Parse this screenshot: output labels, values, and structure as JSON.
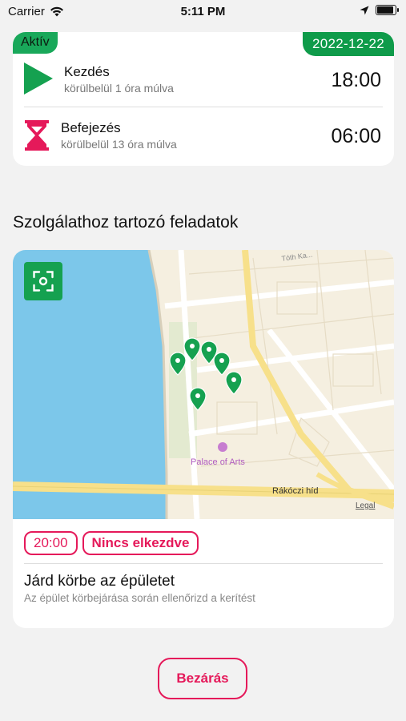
{
  "status_bar": {
    "carrier": "Carrier",
    "time": "5:11 PM"
  },
  "shift": {
    "status_badge": "Aktív",
    "date": "2022-12-22",
    "start": {
      "label": "Kezdés",
      "relative": "körülbelül 1 óra múlva",
      "time": "18:00"
    },
    "end": {
      "label": "Befejezés",
      "relative": "körülbelül 13 óra múlva",
      "time": "06:00"
    }
  },
  "section_title": "Szolgálathoz tartozó feladatok",
  "task": {
    "map": {
      "labels": {
        "poi": "Palace of Arts",
        "bridge": "Rákóczi híd",
        "street": "Tóth Ka...",
        "legal": "Legal"
      },
      "marker_count": 6
    },
    "time_chip": "20:00",
    "status_chip": "Nincs elkezdve",
    "title": "Járd körbe az épületet",
    "description": "Az épület körbejárása során ellenőrizd a kerítést"
  },
  "close_button": "Bezárás",
  "colors": {
    "accent_green": "#15a150",
    "accent_pink": "#e5195a"
  }
}
